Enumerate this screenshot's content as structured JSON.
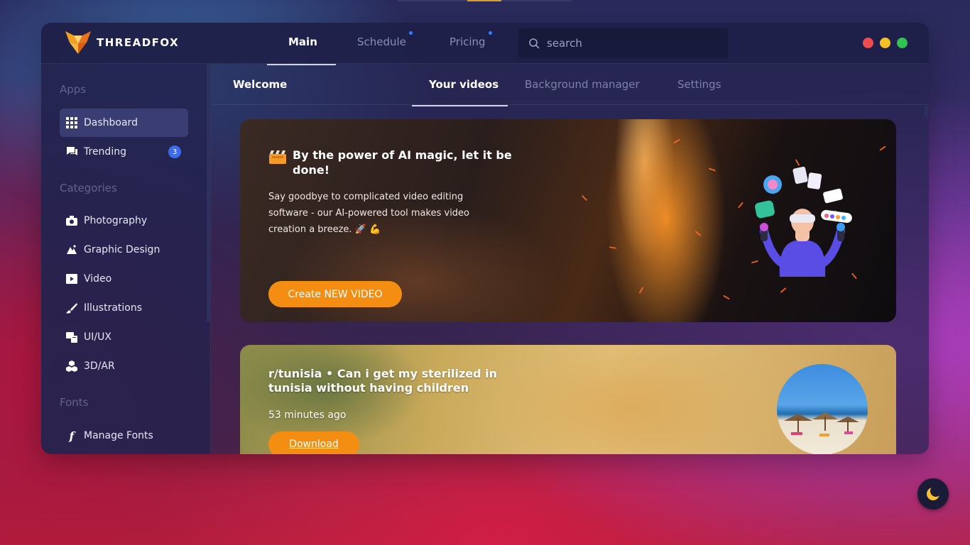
{
  "app": {
    "name": "THREADFOX"
  },
  "header": {
    "tabs": [
      {
        "label": "Main",
        "active": true,
        "dot": false
      },
      {
        "label": "Schedule",
        "active": false,
        "dot": true
      },
      {
        "label": "Pricing",
        "active": false,
        "dot": true
      }
    ],
    "search": {
      "placeholder": "search",
      "value": ""
    },
    "window_controls": {
      "close_color": "#ed4d50",
      "minimize_color": "#f5c027",
      "maximize_color": "#30c553"
    }
  },
  "sidebar": {
    "sections": [
      {
        "heading": "Apps"
      },
      {
        "heading": "Categories"
      },
      {
        "heading": "Fonts"
      }
    ],
    "apps": [
      {
        "label": "Dashboard",
        "icon": "grid-icon",
        "active": true
      },
      {
        "label": "Trending",
        "icon": "chat-icon",
        "badge": "3"
      }
    ],
    "categories": [
      {
        "label": "Photography",
        "icon": "camera-icon"
      },
      {
        "label": "Graphic Design",
        "icon": "design-icon"
      },
      {
        "label": "Video",
        "icon": "video-icon"
      },
      {
        "label": "Illustrations",
        "icon": "brush-icon"
      },
      {
        "label": "UI/UX",
        "icon": "uiux-icon"
      },
      {
        "label": "3D/AR",
        "icon": "cubes-icon"
      }
    ],
    "fonts": [
      {
        "label": "Manage Fonts",
        "icon": "font-icon"
      }
    ]
  },
  "subnav": {
    "title": "Welcome",
    "tabs": [
      {
        "label": "Your videos",
        "active": true
      },
      {
        "label": "Background manager",
        "active": false
      },
      {
        "label": "Settings",
        "active": false
      }
    ]
  },
  "hero": {
    "icon": "clapperboard-icon",
    "title": "By the power of AI magic, let it be done!",
    "description": "Say goodbye to complicated video editing software - our AI-powered tool makes video creation a breeze. 🚀 💪",
    "button_label": "Create NEW VIDEO"
  },
  "post": {
    "title": "r/tunisia • Can i get my sterilized in tunisia without having children",
    "time": "53 minutes ago",
    "button_label": "Download"
  },
  "theme": {
    "accent": "#f38e13",
    "badge": "#3b6cf0",
    "toggle_icon": "moon-icon"
  }
}
